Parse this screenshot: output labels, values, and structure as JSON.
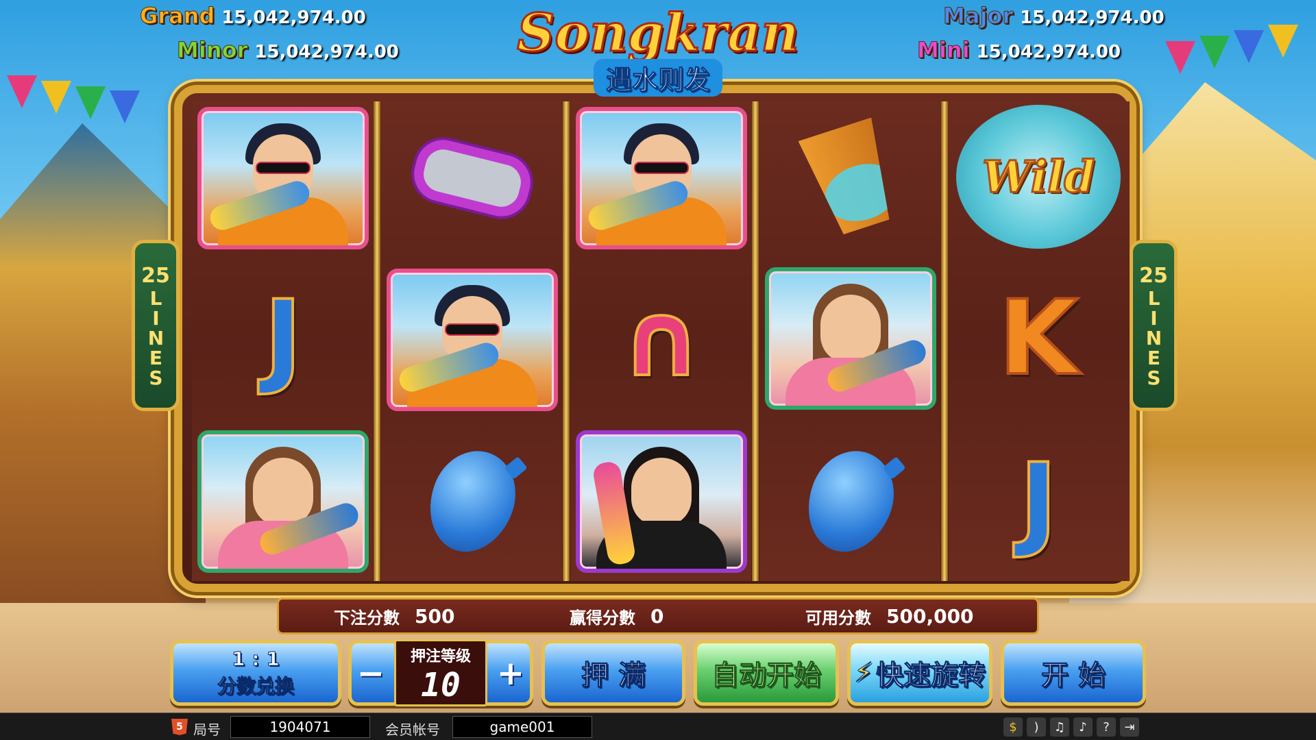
{
  "jackpots": {
    "grand": {
      "label": "Grand",
      "value": "15,042,974.00",
      "color": "#ffb020"
    },
    "minor": {
      "label": "Minor",
      "value": "15,042,974.00",
      "color": "#7ad83a"
    },
    "major": {
      "label": "Major",
      "value": "15,042,974.00",
      "color": "#4a8af0"
    },
    "mini": {
      "label": "Mini",
      "value": "15,042,974.00",
      "color": "#e84ad8"
    }
  },
  "logo": {
    "title": "Songkran",
    "subtitle": "遇水则发"
  },
  "paylines": {
    "count": "25",
    "word": "LINES"
  },
  "reels": [
    [
      "man-water-gun",
      "letter-j",
      "woman-water-gun"
    ],
    [
      "goggles",
      "man-water-gun",
      "water-balloon"
    ],
    [
      "man-water-gun",
      "letter-a",
      "woman-dark-water-gun"
    ],
    [
      "water-bucket",
      "woman-water-gun",
      "water-balloon"
    ],
    [
      "wild",
      "letter-k",
      "letter-j"
    ]
  ],
  "symbols": {
    "j": "J",
    "k": "K",
    "wild": "Wild"
  },
  "info": {
    "bet_label": "下注分數",
    "bet_value": "500",
    "win_label": "赢得分數",
    "win_value": "0",
    "credit_label": "可用分數",
    "credit_value": "500,000"
  },
  "controls": {
    "exchange_ratio": "1 : 1",
    "exchange_label": "分数兑换",
    "minus": "−",
    "plus": "+",
    "bet_level_label": "押注等级",
    "bet_level_value": "10",
    "max_bet": "押 满",
    "auto_start": "自动开始",
    "turbo": "快速旋转",
    "start": "开 始"
  },
  "status_bar": {
    "html5": "5",
    "round_label": "局号",
    "round_value": "1904071",
    "member_label": "会员帐号",
    "member_value": "game001",
    "icons": [
      "coin-icon",
      "rss-icon",
      "music-icon",
      "sound-icon",
      "help-icon",
      "exit-icon"
    ]
  }
}
